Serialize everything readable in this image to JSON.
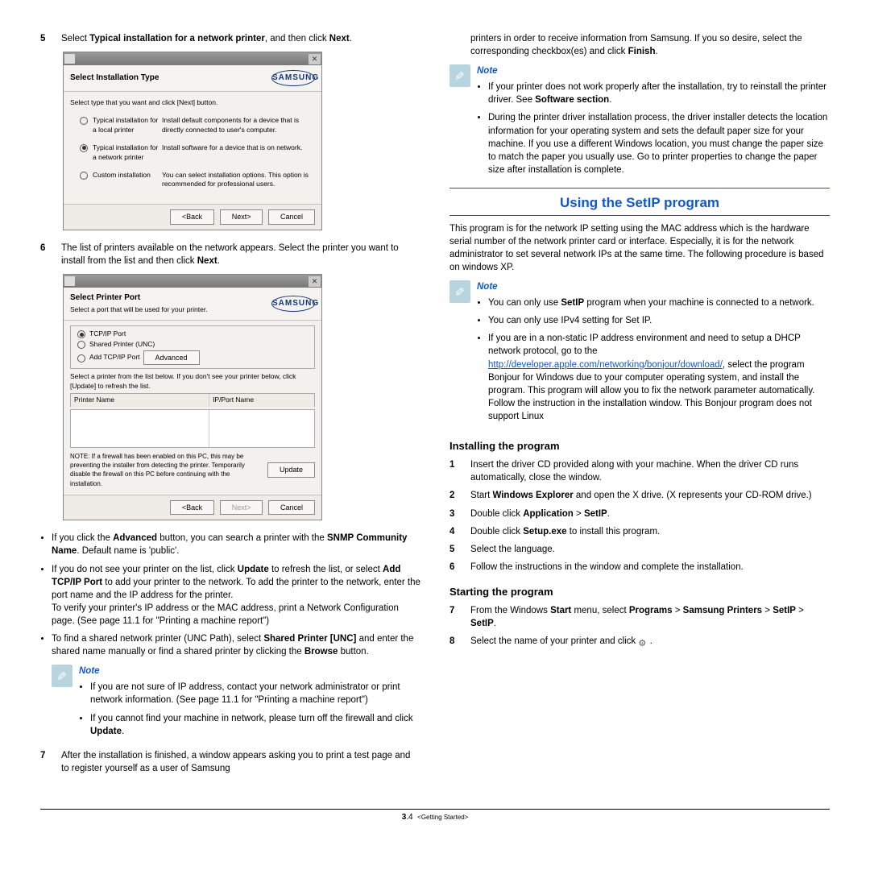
{
  "left": {
    "step5": {
      "num": "5",
      "text_pre": "Select ",
      "text_bold1": "Typical installation for a network printer",
      "text_mid": ", and then click ",
      "text_bold2": "Next",
      "text_end": "."
    },
    "dlg1": {
      "title": "Select Installation Type",
      "brand": "SAMSUNG",
      "hint": "Select type that you want and click [Next] button.",
      "opt1_label": "Typical installation for a local printer",
      "opt1_desc": "Install default components for a device that is directly connected to user's computer.",
      "opt2_label": "Typical installation for a network printer",
      "opt2_desc": "Install software for a device that is on network.",
      "opt3_label": "Custom installation",
      "opt3_desc": "You can select installation options. This option is recommended for professional users.",
      "back": "<Back",
      "next": "Next>",
      "cancel": "Cancel"
    },
    "step6": {
      "num": "6",
      "text_main": "The list of printers available on the network appears. Select the printer you want to install from the list and then click ",
      "text_bold": "Next",
      "text_end": "."
    },
    "dlg2": {
      "title": "Select Printer Port",
      "sub": "Select a port that will be used for your printer.",
      "brand": "SAMSUNG",
      "port1": "TCP/IP Port",
      "port2": "Shared Printer (UNC)",
      "port3": "Add TCP/IP Port",
      "advanced": "Advanced",
      "hint2": "Select a printer from the list below. If you don't see your printer below, click [Update] to refresh the list.",
      "col1": "Printer Name",
      "col2": "IP/Port Name",
      "notetxt": "NOTE: If a firewall has been enabled on this PC, this may be preventing the installer from detecting the printer. Temporarily disable the firewall on this PC before continuing with the installation.",
      "update": "Update",
      "back": "<Back",
      "next": "Next>",
      "cancel": "Cancel"
    },
    "b1_a": "If you click the ",
    "b1_b": "Advanced",
    "b1_c": " button, you can search a printer with the ",
    "b1_d": "SNMP Community Name",
    "b1_e": ". Default name is 'public'.",
    "b2_a": "If you do not see your printer on the list, click ",
    "b2_b": "Update",
    "b2_c": " to refresh the list, or select ",
    "b2_d": "Add TCP/IP Port",
    "b2_e": " to add your printer to the network. To add the printer to the network, enter the port name and the IP address for the printer.",
    "b2_f": "To verify your printer's IP address or the MAC address, print a Network Configuration page. (See  page 11.1 for \"Printing a machine report\")",
    "b3_a": "To find a shared network printer (UNC Path), select ",
    "b3_b": "Shared Printer [UNC]",
    "b3_c": " and enter the shared name manually or find a shared printer by clicking the ",
    "b3_d": "Browse",
    "b3_e": " button.",
    "note1": {
      "title": "Note",
      "l1": "If you are not sure of IP address, contact your network administrator or print network information. (See  page 11.1 for \"Printing a machine report\")",
      "l2_a": "If you cannot find your machine in network, please turn off the firewall and click ",
      "l2_b": "Update",
      "l2_c": "."
    },
    "step7": {
      "num": "7",
      "text": "After the installation is finished, a window appears asking you to print a test page and to register yourself as a user of Samsung"
    }
  },
  "right": {
    "top_a": "printers in order to receive information from Samsung. If you so desire, select the corresponding checkbox(es) and click ",
    "top_b": "Finish",
    "top_c": ".",
    "note2": {
      "title": "Note",
      "l1_a": "If your printer does not work properly after the installation, try to reinstall the printer driver. See ",
      "l1_b": "Software section",
      "l1_c": ".",
      "l2": "During the printer driver installation process, the driver installer detects the location information for your operating system and sets the default paper size for your machine. If you use a different Windows location, you must change the paper size to match the paper you usually use. Go to printer properties to change the paper size after installation is complete."
    },
    "section": "Using the SetIP program",
    "para": "This program is for the network IP setting using the MAC address which is the hardware serial number of the network printer card or interface. Especially, it is for the network administrator to set several network IPs at the same time. The following procedure is based on windows XP.",
    "note3": {
      "title": "Note",
      "l1_a": "You can only use ",
      "l1_b": "SetIP",
      "l1_c": " program when your machine is connected to a network.",
      "l2": "You can only use IPv4 setting for Set IP.",
      "l3_a": "If you are in a non-static IP address environment and need to setup a DHCP network protocol, go to the ",
      "l3_link": "http://developer.apple.com/networking/bonjour/download/",
      "l3_b": ", select the program Bonjour for Windows due to your computer operating system, and install the program. This program will allow you to fix the network parameter automatically. Follow the instruction in the installation window. This Bonjour program does not support Linux"
    },
    "install_h": "Installing the program",
    "s1": {
      "num": "1",
      "txt": "Insert the driver CD provided along with your machine. When the driver CD runs automatically, close the window."
    },
    "s2": {
      "num": "2",
      "a": "Start ",
      "b": "Windows Explorer",
      "c": " and open the X drive. (X represents your CD-ROM drive.)"
    },
    "s3": {
      "num": "3",
      "a": "Double click ",
      "b": "Application",
      "c": " > ",
      "d": "SetIP",
      "e": "."
    },
    "s4": {
      "num": "4",
      "a": "Double click ",
      "b": "Setup.exe",
      "c": " to install this program."
    },
    "s5": {
      "num": "5",
      "txt": "Select the language."
    },
    "s6": {
      "num": "6",
      "txt": "Follow the instructions in the window and complete the installation."
    },
    "start_h": "Starting the program",
    "s7": {
      "num": "7",
      "a": "From the Windows ",
      "b": "Start",
      "c": " menu, select ",
      "d": "Programs",
      "e": " > ",
      "f": "Samsung Printers",
      "g": " > ",
      "h": "SetIP",
      "i": " > ",
      "j": "SetIP",
      "k": "."
    },
    "s8": {
      "num": "8",
      "a": "Select the name of your printer and click ",
      "b": " ."
    }
  },
  "footer": {
    "page": "3",
    "sub": ".4",
    "crumb": "<Getting Started>"
  }
}
